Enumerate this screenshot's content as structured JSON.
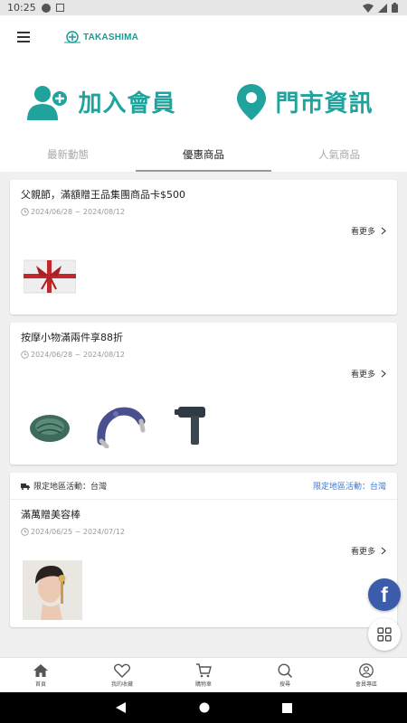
{
  "status_bar": {
    "time": "10:25"
  },
  "header": {
    "logo_text": "TAKASHIMA"
  },
  "hero": {
    "join_label": "加入會員",
    "store_label": "門市資訊"
  },
  "tabs": [
    {
      "label": "最新動態"
    },
    {
      "label": "優惠商品"
    },
    {
      "label": "人氣商品"
    }
  ],
  "active_tab": "優惠商品",
  "cards": [
    {
      "title": "父親節，滿額贈王品集團商品卡$500",
      "date": "2024/06/28 ~ 2024/08/12",
      "more": "看更多"
    },
    {
      "title": "按摩小物滿兩件享88折",
      "date": "2024/06/28 ~ 2024/08/12",
      "more": "看更多"
    },
    {
      "region_label": "限定地區活動：台灣",
      "region_link": "限定地區活動：台灣",
      "title": "滿萬贈美容棒",
      "date": "2024/06/25 ~ 2024/07/12",
      "more": "看更多"
    }
  ],
  "fab": {
    "facebook": "f"
  },
  "bottom_nav": [
    {
      "label": "首頁",
      "icon": "home-icon"
    },
    {
      "label": "我的收藏",
      "icon": "heart-icon"
    },
    {
      "label": "購物車",
      "icon": "cart-icon"
    },
    {
      "label": "搜尋",
      "icon": "search-icon"
    },
    {
      "label": "會員專區",
      "icon": "user-icon"
    }
  ],
  "colors": {
    "brand_teal": "#20a39d",
    "link_blue": "#3a7bd5",
    "facebook_blue": "#3b5bab"
  }
}
